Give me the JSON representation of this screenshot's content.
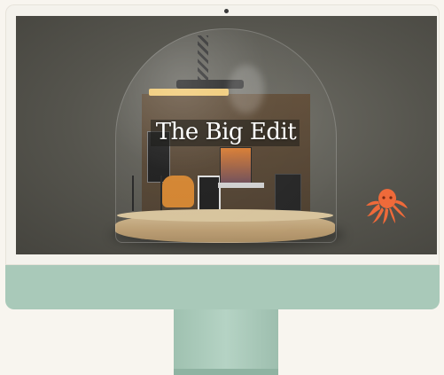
{
  "hero": {
    "headline": "The Big Edit"
  },
  "colors": {
    "screen_bg": "#55544d",
    "monitor_chin": "#a9c9b9",
    "octopus": "#ef6a3a",
    "chair": "#d2822c",
    "page_bg": "#f8f5ef"
  },
  "icons": {
    "logo": "octopus-icon",
    "camera": "camera-dot"
  }
}
